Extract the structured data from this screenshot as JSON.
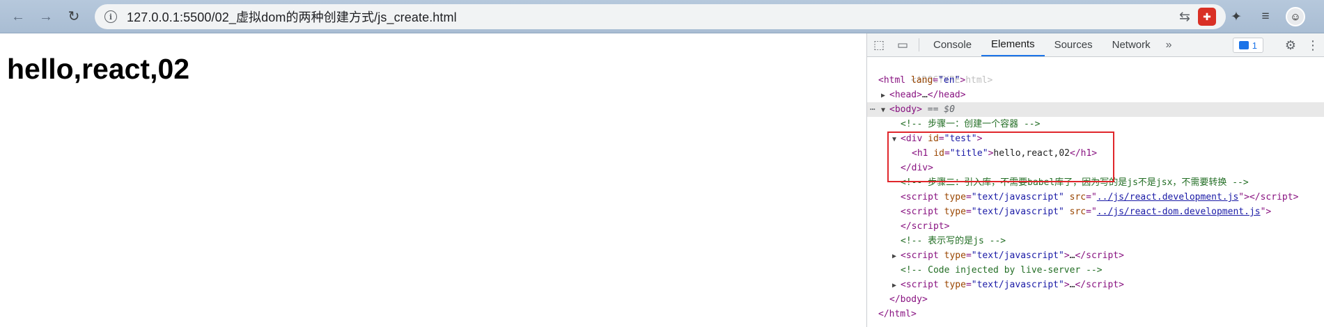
{
  "browser": {
    "url": "127.0.0.1:5500/02_虚拟dom的两种创建方式/js_create.html",
    "nav_back": "←",
    "nav_forward": "→",
    "nav_reload": "↻",
    "info_glyph": "i",
    "translate_glyph": "⇆",
    "star_glyph": "☆",
    "ext_red_glyph": "✚",
    "puzzle_glyph": "✦",
    "media_glyph": "≡",
    "avatar_glyph": "☺",
    "menu_glyph": "⋮"
  },
  "page": {
    "heading": "hello,react,02"
  },
  "devtools": {
    "tabs": [
      "Console",
      "Elements",
      "Sources",
      "Network"
    ],
    "active_tab": "Elements",
    "more_tabs": "»",
    "issues_count": "1",
    "inspect_glyph": "⬚",
    "device_glyph": "▭",
    "settings_glyph": "⚙",
    "menu_glyph": "⋮",
    "dom": {
      "doctype": "<!DOCTYPE html>",
      "html_open_tag": "html",
      "html_lang_attr": "lang",
      "html_lang_val": "\"en\"",
      "head_collapsed": "…",
      "body_tag": "body",
      "body_eq": " == $0",
      "comment1": "<!-- 步骤一：创建一个容器 -->",
      "div_id_val": "\"test\"",
      "h1_id_val": "\"title\"",
      "h1_text": "hello,react,02",
      "comment2": "<!-- 步骤二：引入库，不需要babel库了，因为写的是js不是jsx，不需要转换 -->",
      "script_type_val": "\"text/javascript\"",
      "script1_src": "../js/react.development.js",
      "script2_src": "../js/react-dom.development.js",
      "comment3": "<!-- 表示写的是js -->",
      "comment4": "<!-- Code injected by live-server -->",
      "ellipsis": "…"
    }
  }
}
